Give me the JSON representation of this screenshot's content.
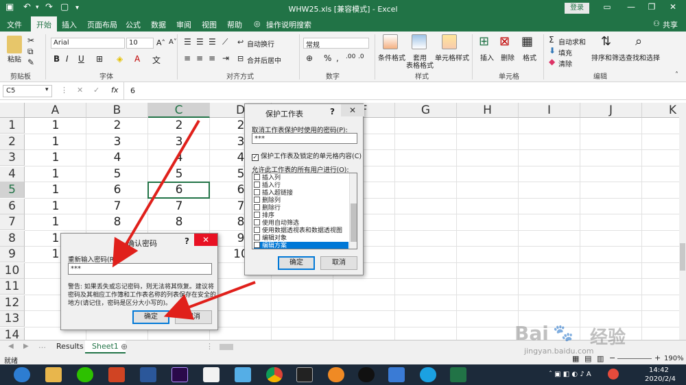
{
  "titlebar": {
    "title": "WHW25.xls  [兼容模式]  -  Excel",
    "login": "登录"
  },
  "tabs": [
    "文件",
    "开始",
    "插入",
    "页面布局",
    "公式",
    "数据",
    "审阅",
    "视图",
    "帮助"
  ],
  "tell_me": "操作说明搜索",
  "share": "共享",
  "ribbon": {
    "paste": "粘贴",
    "font_name": "Arial",
    "font_size": "10",
    "bold": "B",
    "italic": "I",
    "underline": "U",
    "wrap_text": "自动换行",
    "merge_center": "合并后居中",
    "number_format": "常规",
    "conditional_format": "条件格式",
    "table_format": "套用\n表格格式",
    "table_format_1": "套用",
    "table_format_2": "表格格式",
    "cell_style": "单元格样式",
    "insert": "插入",
    "delete": "删除",
    "format": "格式",
    "autosum": "自动求和",
    "fill": "填充",
    "clear": "清除",
    "sort_filter": "排序和筛选",
    "find_select": "查找和选择",
    "groups": {
      "clipboard": "剪贴板",
      "font": "字体",
      "alignment": "对齐方式",
      "number": "数字",
      "styles": "样式",
      "cells": "单元格",
      "editing": "编辑"
    }
  },
  "formula_bar": {
    "name_box": "C5",
    "fx": "fx",
    "value": "6"
  },
  "columns": [
    "A",
    "B",
    "C",
    "D",
    "E",
    "F",
    "G",
    "H",
    "I",
    "J",
    "K"
  ],
  "rows": [
    "1",
    "2",
    "3",
    "4",
    "5",
    "6",
    "7",
    "8",
    "9",
    "10",
    "11",
    "12",
    "13",
    "14"
  ],
  "cells": {
    "A": [
      "1",
      "1",
      "1",
      "1",
      "1",
      "1",
      "1",
      "1",
      "1"
    ],
    "B": [
      "2",
      "3",
      "4",
      "5",
      "6",
      "7",
      "8"
    ],
    "C": [
      "2",
      "3",
      "4",
      "5",
      "6",
      "7",
      "8"
    ],
    "D": [
      "2",
      "3",
      "4",
      "5",
      "6",
      "7",
      "8",
      "9",
      "10"
    ]
  },
  "sheets": [
    "Results",
    "Sheet1"
  ],
  "status": {
    "ready": "就绪",
    "zoom": "190%"
  },
  "protect_dialog": {
    "title": "保护工作表",
    "help": "?",
    "close": "✕",
    "password_label": "取消工作表保护时使用的密码(P):",
    "password_value": "***",
    "protect_check": "保护工作表及锁定的单元格内容(C)",
    "allow_label": "允许此工作表的所有用户进行(O):",
    "options": [
      "插入列",
      "插入行",
      "插入超链接",
      "删除列",
      "删除行",
      "排序",
      "使用自动筛选",
      "使用数据透视表和数据透视图",
      "编辑对象",
      "编辑方案"
    ],
    "ok": "确定",
    "cancel": "取消"
  },
  "confirm_dialog": {
    "title": "确认密码",
    "help": "?",
    "close": "✕",
    "reenter_label": "重新输入密码(R):",
    "password_value": "***",
    "warning_1": "警告: 如果丢失或忘记密码，则无法将其恢复。建议将",
    "warning_2": "密码及其相应工作簿和工作表名称的列表保存在安全的",
    "warning_3": "地方(请记住，密码是区分大小写的)。",
    "ok": "确定",
    "cancel": "取消"
  },
  "taskbar": {
    "time": "14:42",
    "date": "2020/2/4"
  },
  "watermark": {
    "brand": "Bai",
    "brand2": "经验",
    "url": "jingyan.baidu.com"
  },
  "colors": {
    "excel_green": "#217346",
    "close_red": "#e81123",
    "arrow_red": "#e0201b",
    "selection_blue": "#0078d7"
  }
}
